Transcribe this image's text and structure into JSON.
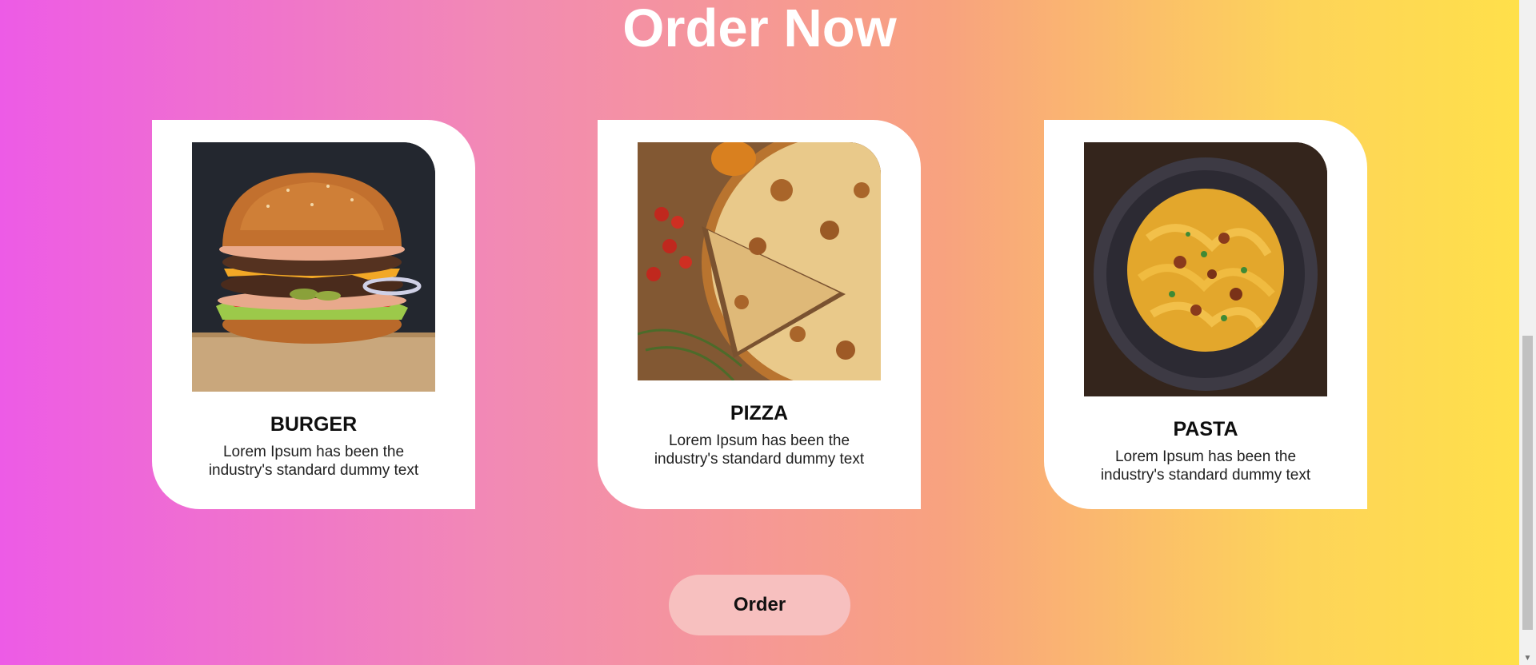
{
  "section": {
    "heading": "Order Now"
  },
  "cards": [
    {
      "title": "BURGER",
      "description": "Lorem Ipsum has been the industry's standard dummy text",
      "image_icon": "burger-image"
    },
    {
      "title": "PIZZA",
      "description": "Lorem Ipsum has been the industry's standard dummy text",
      "image_icon": "pizza-image"
    },
    {
      "title": "PASTA",
      "description": "Lorem Ipsum has been the industry's standard dummy text",
      "image_icon": "pasta-image"
    }
  ],
  "order_button": {
    "label": "Order"
  },
  "colors": {
    "gradient_start": "#ed5be6",
    "gradient_end": "#ffe04a",
    "button_bg": "#f7c0bf",
    "card_bg": "#ffffff"
  }
}
